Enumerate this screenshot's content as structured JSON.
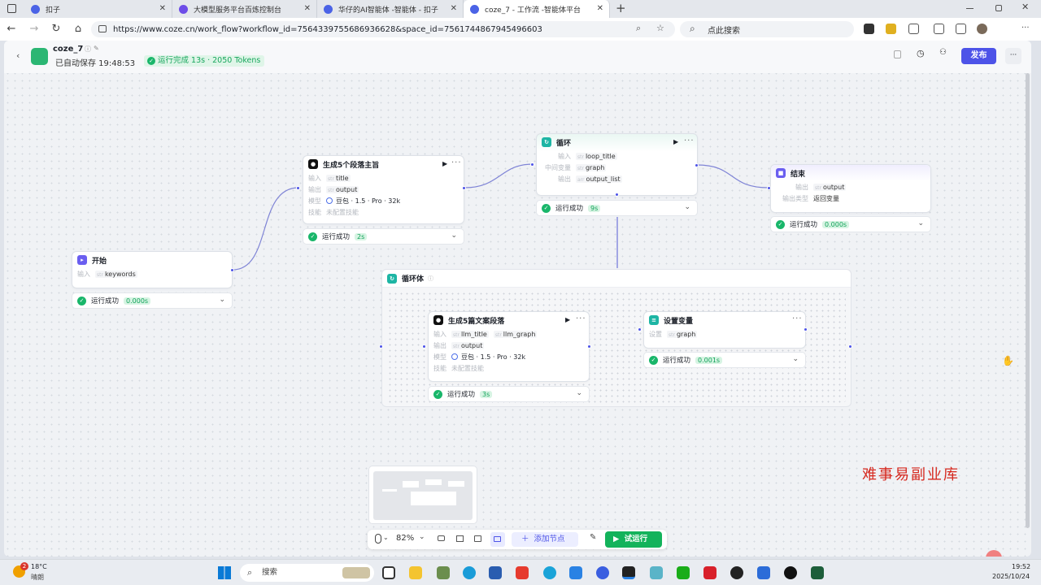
{
  "browser": {
    "tabs": [
      {
        "label": "扣子"
      },
      {
        "label": "大模型服务平台百炼控制台"
      },
      {
        "label": "华仔的AI智能体 -智能体 - 扣子"
      },
      {
        "label": "coze_7 - 工作流 -智能体平台"
      }
    ],
    "new_tab": "+",
    "url": "https://www.coze.cn/work_flow?workflow_id=7564339755686936628&space_id=7561744867945496603",
    "search_placeholder": "点此搜索"
  },
  "app": {
    "workflow_name": "coze_7",
    "autosave": "已自动保存 19:48:53",
    "run_badge": "运行完成 13s · 2050 Tokens",
    "publish": "发布"
  },
  "nodes": {
    "start": {
      "title": "开始",
      "in_label": "输入",
      "param": "keywords",
      "status": "运行成功",
      "time": "0.000s"
    },
    "gen5": {
      "title": "生成5个段落主旨",
      "in_label": "输入",
      "in_param": "title",
      "out_label": "输出",
      "out_param": "output",
      "model_label": "模型",
      "model": "豆包 · 1.5 · Pro · 32k",
      "skill_label": "技能",
      "skill": "未配置技能",
      "status": "运行成功",
      "time": "2s"
    },
    "loop": {
      "title": "循环",
      "in_label": "输入",
      "in_param": "loop_title",
      "mid_label": "中间变量",
      "mid_param": "graph",
      "out_label": "输出",
      "out_param": "output_list",
      "status": "运行成功",
      "time": "9s"
    },
    "end": {
      "title": "结束",
      "out_label": "输出",
      "out_param": "output",
      "type_label": "输出类型",
      "type": "返回变量",
      "status": "运行成功",
      "time": "0.000s"
    },
    "loopbody": {
      "title": "循环体"
    },
    "gen_para": {
      "title": "生成5篇文案段落",
      "in_label": "输入",
      "in_param1": "llm_title",
      "in_param2": "llm_graph",
      "out_label": "输出",
      "out_param": "output",
      "model_label": "模型",
      "model": "豆包 · 1.5 · Pro · 32k",
      "skill_label": "技能",
      "skill": "未配置技能",
      "status": "运行成功",
      "time": "3s"
    },
    "setvar": {
      "title": "设置变量",
      "set_label": "设置",
      "set_param": "graph",
      "status": "运行成功",
      "time": "0.001s"
    }
  },
  "toolbar": {
    "zoom": "82%",
    "add_node": "添加节点",
    "test_run": "试运行"
  },
  "watermark": "难事易副业库",
  "taskbar": {
    "temp": "18°C",
    "weather": "晴朗",
    "search": "搜索",
    "time": "19:52",
    "date": "2025/10/24",
    "badge": "2"
  },
  "colors": {
    "accent": "#4d53e8",
    "success": "#19b66a",
    "run_button": "#13b35b"
  }
}
